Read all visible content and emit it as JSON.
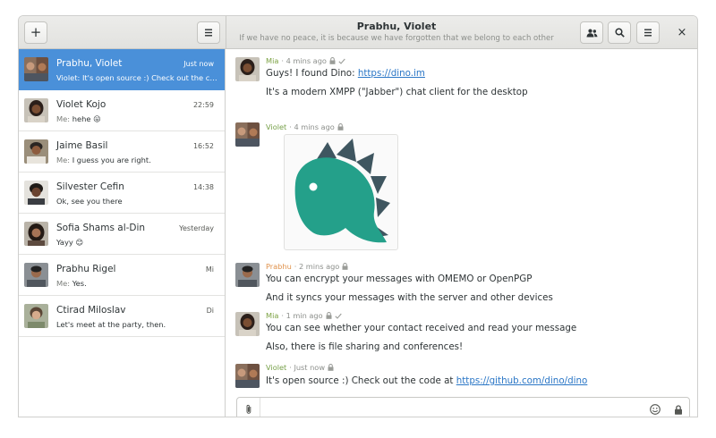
{
  "header": {
    "title": "Prabhu, Violet",
    "subtitle": "If we have no peace, it is because we have forgotten that we belong to each other",
    "add_label": "+",
    "sidebar_menu_icon": "hamburger-icon",
    "participants_icon": "people-icon",
    "search_icon": "search-icon",
    "menu_icon": "hamburger-icon",
    "close_label": "×"
  },
  "conversations": [
    {
      "name": "Prabhu, Violet",
      "time": "Just now",
      "who": "Violet:",
      "preview": "It's open source :) Check out the co...",
      "selected": true
    },
    {
      "name": "Violet Kojo",
      "time": "22:59",
      "who": "Me:",
      "preview": "hehe 😛"
    },
    {
      "name": "Jaime Basil",
      "time": "16:52",
      "who": "Me:",
      "preview": "I guess you are right."
    },
    {
      "name": "Silvester Cefin",
      "time": "14:38",
      "who": "",
      "preview": "Ok, see you there"
    },
    {
      "name": "Sofia Shams al-Din",
      "time": "Yesterday",
      "who": "",
      "preview": "Yayy 😊"
    },
    {
      "name": "Prabhu Rigel",
      "time": "Mi",
      "who": "Me:",
      "preview": "Yes."
    },
    {
      "name": "Ctirad Miloslav",
      "time": "Di",
      "who": "",
      "preview": "Let's meet at the party, then."
    }
  ],
  "messages": {
    "m1": {
      "sender": "Mia",
      "time": "· 4 mins ago",
      "line1": "Guys! I found Dino: ",
      "link": "https://dino.im",
      "line2": "It's a modern XMPP (\"Jabber\") chat client for the desktop"
    },
    "m2": {
      "sender": "Violet",
      "time": "· 4 mins ago"
    },
    "m3": {
      "sender": "Prabhu",
      "time": "· 2 mins ago",
      "line1": "You can encrypt your messages with OMEMO or OpenPGP",
      "line2": "And it syncs your messages with the server and other devices"
    },
    "m4": {
      "sender": "Mia",
      "time": "· 1 min ago",
      "line1": "You can see whether your contact received and read your message",
      "line2": "Also, there is file sharing and conferences!"
    },
    "m5": {
      "sender": "Violet",
      "time": "· Just now",
      "line1": "It's open source :) Check out the code at ",
      "link": "https://github.com/dino/dino"
    }
  },
  "composer": {
    "value": "",
    "placeholder": ""
  },
  "colors": {
    "accent": "#4a90d9",
    "mia": "#7ca243",
    "violet": "#77a04a",
    "prabhu": "#e0924c",
    "dino": "#24a08a",
    "dino_spikes": "#3f5660"
  }
}
